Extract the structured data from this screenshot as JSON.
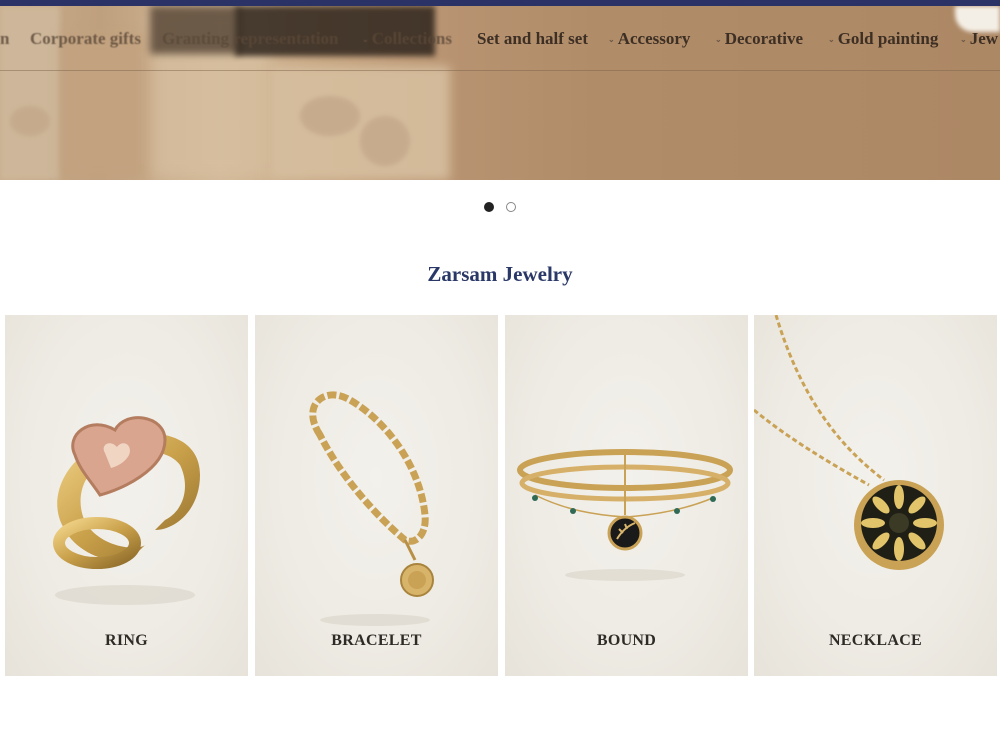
{
  "nav": {
    "items": [
      {
        "label": "n",
        "faded": true
      },
      {
        "label": "Corporate gifts",
        "faded": true
      },
      {
        "label": "Granting representation",
        "faded": true
      },
      {
        "label": "Collections",
        "faded": true
      },
      {
        "label": "Set and half set",
        "faded": false
      },
      {
        "label": "Accessory",
        "faded": false
      },
      {
        "label": "Decorative",
        "faded": false
      },
      {
        "label": "Gold painting",
        "faded": false
      },
      {
        "label": "Jew",
        "faded": false
      }
    ]
  },
  "carousel": {
    "slides": 2,
    "active": 1
  },
  "section": {
    "title": "Zarsam Jewelry"
  },
  "categories": [
    {
      "label": "RING",
      "icon": "ring-image"
    },
    {
      "label": "BRACELET",
      "icon": "bracelet-image"
    },
    {
      "label": "BOUND",
      "icon": "bound-image"
    },
    {
      "label": "NECKLACE",
      "icon": "necklace-image"
    }
  ],
  "colors": {
    "accent": "#2a3868",
    "topbar": "#2b3266",
    "gold": "#c9a255"
  }
}
